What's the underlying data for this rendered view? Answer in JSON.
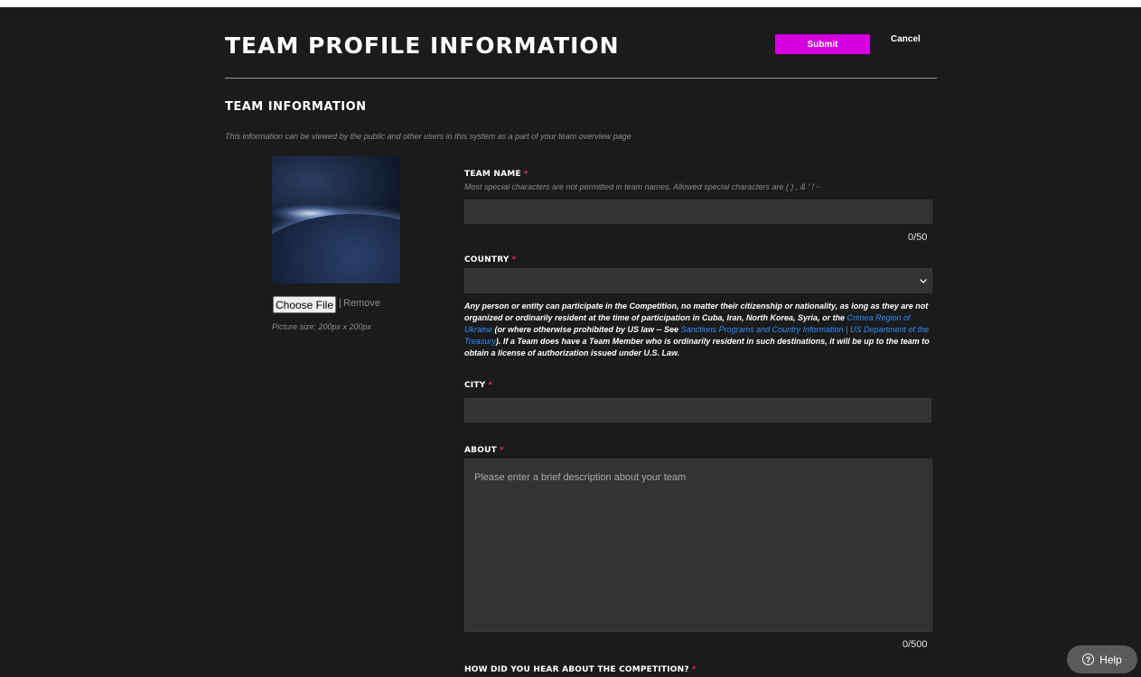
{
  "header": {
    "title": "TEAM PROFILE INFORMATION",
    "submit_label": "Submit",
    "cancel_label": "Cancel"
  },
  "section": {
    "title": "TEAM INFORMATION",
    "description": "This information can be viewed by the public and other users in this system as a part of your team overview page"
  },
  "image_upload": {
    "choose_file_label": "Choose File",
    "separator": "|",
    "remove_label": "Remove",
    "picture_size": "Picture size: 200px x 200px"
  },
  "fields": {
    "team_name": {
      "label": "TEAM NAME",
      "required_mark": "*",
      "help": "Most special characters are not permitted in team names. Allowed special characters are ( ) , & ' ! -",
      "value": "",
      "counter": "0/50"
    },
    "country": {
      "label": "COUNTRY",
      "required_mark": "*",
      "selected": "",
      "notice": {
        "part1": "Any person or entity can participate in the Competition, no matter their citizenship or nationality, as long as they are not organized or ordinarily resident at the time of participation in Cuba, Iran, North Korea, Syria, or the ",
        "link1": "Crimea Region of Ukraine",
        "part2": " (or where otherwise prohibited by US law -- See ",
        "link2": "Sanctions Programs and Country Information | US Department of the Treasury",
        "part3": "). If a Team does have a Team Member who is ordinarily resident in such destinations, it will be up to the team to obtain a license of authorization issued under U.S. Law."
      }
    },
    "city": {
      "label": "CITY",
      "required_mark": "*",
      "value": ""
    },
    "about": {
      "label": "ABOUT",
      "required_mark": "*",
      "placeholder": "Please enter a brief description about your team",
      "counter": "0/500"
    },
    "how_heard": {
      "label": "HOW DID YOU HEAR ABOUT THE COMPETITION?",
      "required_mark": "*"
    }
  },
  "help_button": {
    "label": "Help",
    "icon_glyph": "?"
  },
  "colors": {
    "background": "#1b1b1b",
    "accent": "#d400e0",
    "input_bg": "#333333",
    "required": "#e1245f",
    "link": "#2f8fff"
  }
}
